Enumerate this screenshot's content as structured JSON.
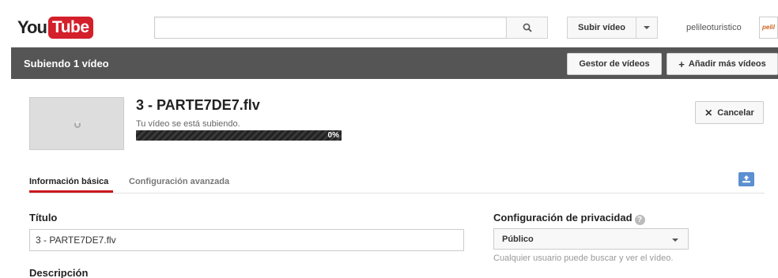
{
  "masthead": {
    "logo_you": "You",
    "logo_tube": "Tube",
    "search_placeholder": "",
    "upload_label": "Subir vídeo",
    "username": "pelileoturistico",
    "avatar_text": "pelil"
  },
  "topbar": {
    "title": "Subiendo 1 vídeo",
    "manager_label": "Gestor de vídeos",
    "add_label": "Añadir más vídeos"
  },
  "upload": {
    "filename": "3 - PARTE7DE7.flv",
    "status": "Tu vídeo se está subiendo.",
    "progress_percent": 0,
    "progress_label": "0%",
    "cancel_label": "Cancelar"
  },
  "tabs": [
    {
      "label": "Información básica",
      "active": true
    },
    {
      "label": "Configuración avanzada",
      "active": false
    }
  ],
  "form": {
    "title_label": "Título",
    "title_value": "3 - PARTE7DE7.flv",
    "description_label": "Descripción",
    "privacy_label": "Configuración de privacidad",
    "privacy_value": "Público",
    "privacy_help": "Cualquier usuario puede buscar y ver el vídeo."
  },
  "colors": {
    "brand_red": "#d3202b",
    "tab_active": "#cc181e",
    "topbar_bg": "#555555",
    "accent_blue": "#5b8fd1"
  },
  "icons": [
    "search-icon",
    "chevron-down-icon",
    "plus-icon",
    "close-icon",
    "upload-thumbnail-icon",
    "help-icon",
    "loading-spinner-icon"
  ]
}
